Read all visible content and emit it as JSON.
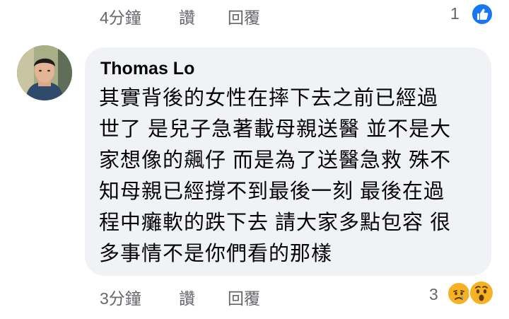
{
  "previous_comment": {
    "time": "4分鐘",
    "like_label": "讚",
    "reply_label": "回覆",
    "reaction_count": "1",
    "reaction_icons": [
      "like-icon"
    ]
  },
  "comment": {
    "author": "Thomas Lo",
    "text_lines": [
      "其實背後的女性在摔下去之前已經過",
      "世了 是兒子急著載母親送醫 並不是大",
      "家想像的飆仔 而是為了送醫急救 殊不",
      "知母親已經撐不到最後一刻 最後在過",
      "程中癱軟的跌下去 請大家多點包容 很",
      "多事情不是你們看的那樣"
    ],
    "time": "3分鐘",
    "like_label": "讚",
    "reply_label": "回覆",
    "reaction_count": "3",
    "reaction_icons": [
      "sad-icon",
      "wow-icon"
    ]
  },
  "colors": {
    "bubble": "#f0f2f5",
    "like_blue": "#1877f2",
    "reaction_yellow": "#f7b125",
    "meta_gray": "#65676b"
  }
}
